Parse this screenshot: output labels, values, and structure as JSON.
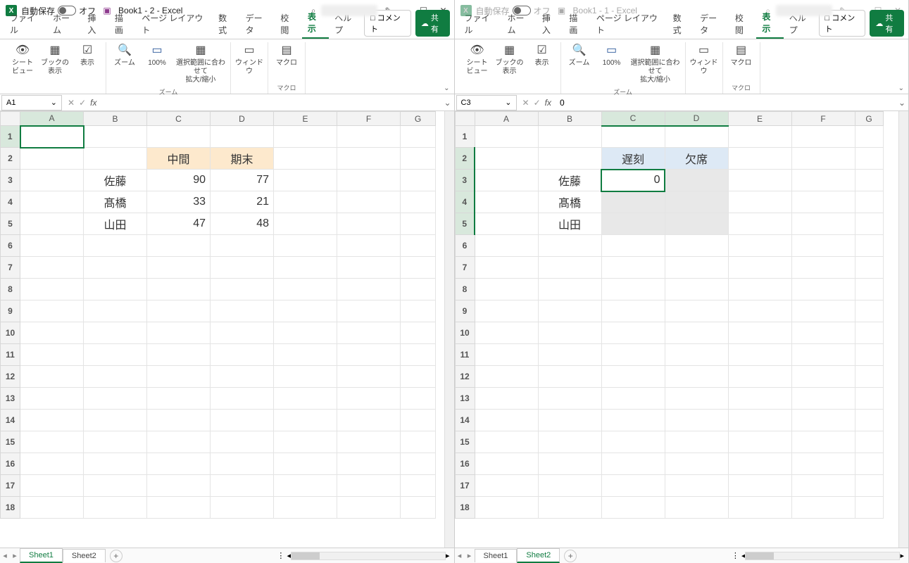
{
  "left": {
    "titlebar": {
      "autosave_label": "自動保存",
      "autosave_state": "オフ",
      "title": "Book1 - 2 - Excel"
    },
    "tabs": {
      "file": "ファイル",
      "home": "ホーム",
      "insert": "挿入",
      "draw": "描画",
      "layout": "ページ レイアウト",
      "formula": "数式",
      "data": "データ",
      "review": "校閲",
      "view": "表示",
      "help": "ヘルプ",
      "comment": "コメント",
      "share": "共有"
    },
    "ribbon": {
      "sheetview": "シート\nビュー",
      "bookview": "ブックの\n表示",
      "show": "表示",
      "zoom": "ズーム",
      "p100": "100%",
      "fitsel": "選択範囲に合わせて\n拡大/縮小",
      "window": "ウィンドウ",
      "macro": "マクロ",
      "g_zoom": "ズーム",
      "g_macro": "マクロ"
    },
    "formula": {
      "cell": "A1",
      "value": ""
    },
    "cols": [
      "A",
      "B",
      "C",
      "D",
      "E",
      "F",
      "G"
    ],
    "rows": [
      "1",
      "2",
      "3",
      "4",
      "5",
      "6",
      "7",
      "8",
      "9",
      "10",
      "11",
      "12",
      "13",
      "14",
      "15",
      "16",
      "17",
      "18"
    ],
    "data": {
      "C2": "中間",
      "D2": "期末",
      "B3": "佐藤",
      "C3": "90",
      "D3": "77",
      "B4": "髙橋",
      "C4": "33",
      "D4": "21",
      "B5": "山田",
      "C5": "47",
      "D5": "48"
    },
    "sheets": {
      "s1": "Sheet1",
      "s2": "Sheet2"
    }
  },
  "right": {
    "titlebar": {
      "autosave_label": "自動保存",
      "autosave_state": "オフ",
      "title": "Book1 - 1 - Excel"
    },
    "tabs": {
      "file": "ファイル",
      "home": "ホーム",
      "insert": "挿入",
      "draw": "描画",
      "layout": "ページ レイアウト",
      "formula": "数式",
      "data": "データ",
      "review": "校閲",
      "view": "表示",
      "help": "ヘルプ",
      "comment": "コメント",
      "share": "共有"
    },
    "ribbon": {
      "sheetview": "シート\nビュー",
      "bookview": "ブックの\n表示",
      "show": "表示",
      "zoom": "ズーム",
      "p100": "100%",
      "fitsel": "選択範囲に合わせて\n拡大/縮小",
      "window": "ウィンドウ",
      "macro": "マクロ",
      "g_zoom": "ズーム",
      "g_macro": "マクロ"
    },
    "formula": {
      "cell": "C3",
      "value": "0"
    },
    "cols": [
      "A",
      "B",
      "C",
      "D",
      "E",
      "F",
      "G"
    ],
    "rows": [
      "1",
      "2",
      "3",
      "4",
      "5",
      "6",
      "7",
      "8",
      "9",
      "10",
      "11",
      "12",
      "13",
      "14",
      "15",
      "16",
      "17",
      "18"
    ],
    "data": {
      "C2": "遅刻",
      "D2": "欠席",
      "B3": "佐藤",
      "C3": "0",
      "B4": "髙橋",
      "B5": "山田"
    },
    "sheets": {
      "s1": "Sheet1",
      "s2": "Sheet2"
    }
  }
}
